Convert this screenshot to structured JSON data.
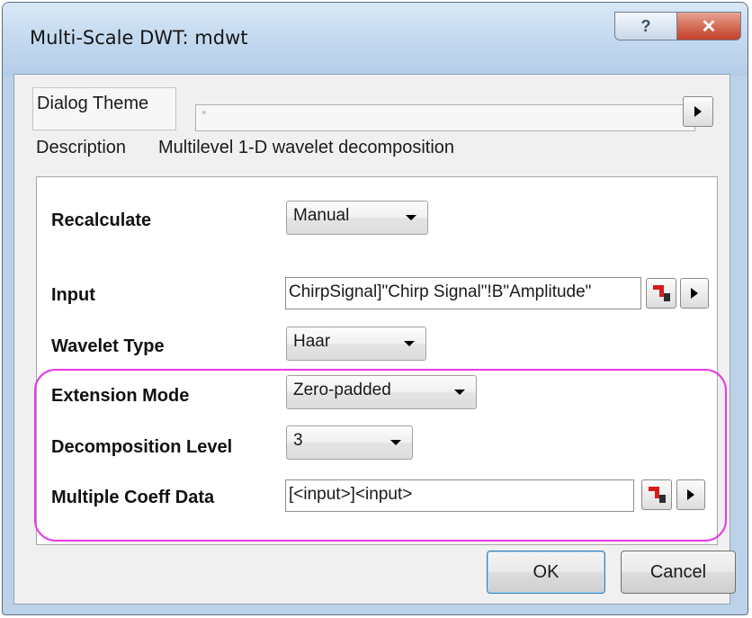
{
  "window": {
    "title": "Multi-Scale DWT: mdwt",
    "help_glyph": "?",
    "close_glyph": "✕"
  },
  "theme": {
    "label": "Dialog Theme",
    "value": "*"
  },
  "description": {
    "label": "Description",
    "text": "Multilevel 1-D wavelet decomposition"
  },
  "settings": {
    "recalculate": {
      "label": "Recalculate",
      "value": "Manual"
    },
    "input": {
      "label": "Input",
      "value": "ChirpSignal]\"Chirp Signal\"!B\"Amplitude\""
    },
    "wavelet_type": {
      "label": "Wavelet Type",
      "value": "Haar"
    },
    "extension_mode": {
      "label": "Extension Mode",
      "value": "Zero-padded"
    },
    "decomposition_level": {
      "label": "Decomposition Level",
      "value": "3"
    },
    "multiple_coeff_data": {
      "label": "Multiple Coeff Data",
      "value": "[<input>]<input>"
    }
  },
  "buttons": {
    "ok": "OK",
    "cancel": "Cancel"
  },
  "colors": {
    "highlight": "#e838e8",
    "titlebar": "#c5daf0",
    "close": "#c4402a"
  }
}
